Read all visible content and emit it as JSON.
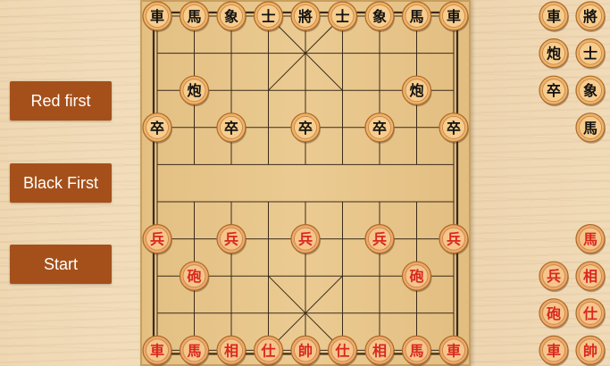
{
  "buttons": {
    "red_first": "Red first",
    "black_first": "Black First",
    "start": "Start"
  },
  "colors": {
    "button_bg": "#a5501a",
    "red_piece_text": "#d8281e",
    "black_piece_text": "#111111"
  },
  "board": {
    "files": 9,
    "ranks": 10,
    "pieces": [
      {
        "char": "車",
        "side": "black",
        "file": 0,
        "rank": 0
      },
      {
        "char": "馬",
        "side": "black",
        "file": 1,
        "rank": 0
      },
      {
        "char": "象",
        "side": "black",
        "file": 2,
        "rank": 0
      },
      {
        "char": "士",
        "side": "black",
        "file": 3,
        "rank": 0
      },
      {
        "char": "將",
        "side": "black",
        "file": 4,
        "rank": 0
      },
      {
        "char": "士",
        "side": "black",
        "file": 5,
        "rank": 0
      },
      {
        "char": "象",
        "side": "black",
        "file": 6,
        "rank": 0
      },
      {
        "char": "馬",
        "side": "black",
        "file": 7,
        "rank": 0
      },
      {
        "char": "車",
        "side": "black",
        "file": 8,
        "rank": 0
      },
      {
        "char": "炮",
        "side": "black",
        "file": 1,
        "rank": 2
      },
      {
        "char": "炮",
        "side": "black",
        "file": 7,
        "rank": 2
      },
      {
        "char": "卒",
        "side": "black",
        "file": 0,
        "rank": 3
      },
      {
        "char": "卒",
        "side": "black",
        "file": 2,
        "rank": 3
      },
      {
        "char": "卒",
        "side": "black",
        "file": 4,
        "rank": 3
      },
      {
        "char": "卒",
        "side": "black",
        "file": 6,
        "rank": 3
      },
      {
        "char": "卒",
        "side": "black",
        "file": 8,
        "rank": 3
      },
      {
        "char": "兵",
        "side": "red",
        "file": 0,
        "rank": 6
      },
      {
        "char": "兵",
        "side": "red",
        "file": 2,
        "rank": 6
      },
      {
        "char": "兵",
        "side": "red",
        "file": 4,
        "rank": 6
      },
      {
        "char": "兵",
        "side": "red",
        "file": 6,
        "rank": 6
      },
      {
        "char": "兵",
        "side": "red",
        "file": 8,
        "rank": 6
      },
      {
        "char": "砲",
        "side": "red",
        "file": 1,
        "rank": 7
      },
      {
        "char": "砲",
        "side": "red",
        "file": 7,
        "rank": 7
      },
      {
        "char": "車",
        "side": "red",
        "file": 0,
        "rank": 9
      },
      {
        "char": "馬",
        "side": "red",
        "file": 1,
        "rank": 9
      },
      {
        "char": "相",
        "side": "red",
        "file": 2,
        "rank": 9
      },
      {
        "char": "仕",
        "side": "red",
        "file": 3,
        "rank": 9
      },
      {
        "char": "帥",
        "side": "red",
        "file": 4,
        "rank": 9
      },
      {
        "char": "仕",
        "side": "red",
        "file": 5,
        "rank": 9
      },
      {
        "char": "相",
        "side": "red",
        "file": 6,
        "rank": 9
      },
      {
        "char": "馬",
        "side": "red",
        "file": 7,
        "rank": 9
      },
      {
        "char": "車",
        "side": "red",
        "file": 8,
        "rank": 9
      }
    ]
  },
  "side_pieces": [
    {
      "char": "車",
      "side": "black",
      "col": 0,
      "row": 0
    },
    {
      "char": "將",
      "side": "black",
      "col": 1,
      "row": 0
    },
    {
      "char": "炮",
      "side": "black",
      "col": 0,
      "row": 1
    },
    {
      "char": "士",
      "side": "black",
      "col": 1,
      "row": 1
    },
    {
      "char": "卒",
      "side": "black",
      "col": 0,
      "row": 2
    },
    {
      "char": "象",
      "side": "black",
      "col": 1,
      "row": 2
    },
    {
      "char": "馬",
      "side": "black",
      "col": 1,
      "row": 3
    },
    {
      "char": "馬",
      "side": "red",
      "col": 1,
      "row": 6
    },
    {
      "char": "兵",
      "side": "red",
      "col": 0,
      "row": 7
    },
    {
      "char": "相",
      "side": "red",
      "col": 1,
      "row": 7
    },
    {
      "char": "砲",
      "side": "red",
      "col": 0,
      "row": 8
    },
    {
      "char": "仕",
      "side": "red",
      "col": 1,
      "row": 8
    },
    {
      "char": "車",
      "side": "red",
      "col": 0,
      "row": 9
    },
    {
      "char": "帥",
      "side": "red",
      "col": 1,
      "row": 9
    }
  ]
}
